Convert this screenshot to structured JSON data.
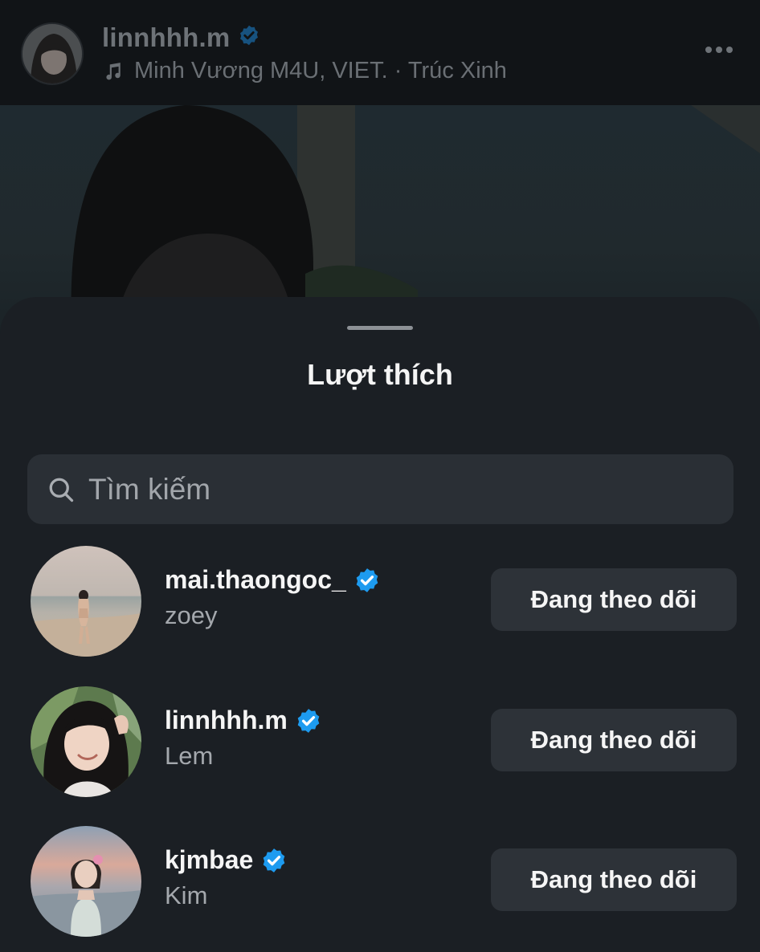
{
  "post": {
    "username": "linnhhh.m",
    "music_text": "Minh Vương M4U, VIET. · Trúc Xinh"
  },
  "sheet": {
    "title": "Lượt thích",
    "search_placeholder": "Tìm kiếm"
  },
  "likes": [
    {
      "username": "mai.thaongoc_",
      "name": "zoey",
      "verified": true,
      "button": "Đang theo dõi"
    },
    {
      "username": "linnhhh.m",
      "name": "Lem",
      "verified": true,
      "button": "Đang theo dõi"
    },
    {
      "username": "kjmbae",
      "name": "Kim",
      "verified": true,
      "button": "Đang theo dõi"
    }
  ],
  "colors": {
    "background": "#1b1f24",
    "verified_blue": "#1d9bf0",
    "button_bg": "#2d3238",
    "search_bg": "#2a2f35"
  }
}
